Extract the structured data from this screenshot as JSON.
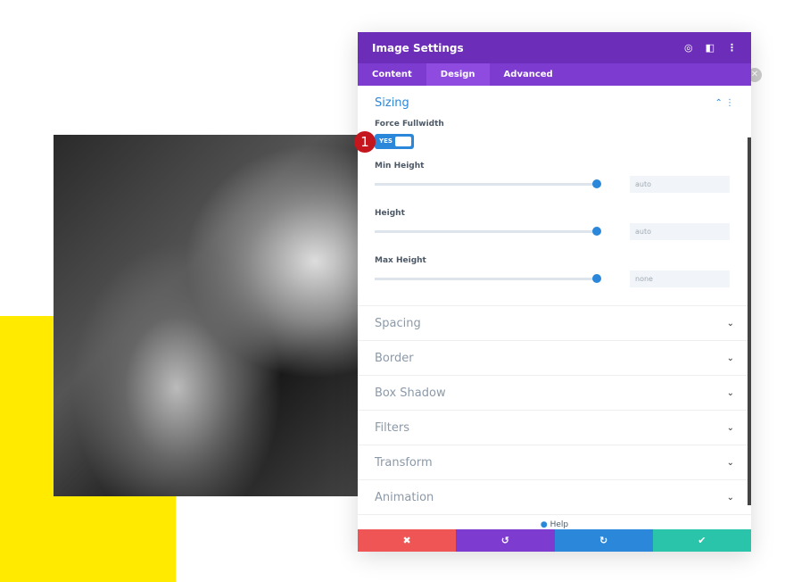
{
  "panel": {
    "title": "Image Settings",
    "tabs": [
      "Content",
      "Design",
      "Advanced"
    ],
    "active_tab": "Design"
  },
  "sizing": {
    "title": "Sizing",
    "force_fullwidth_label": "Force Fullwidth",
    "toggle": "YES",
    "fields": [
      {
        "label": "Min Height",
        "value": "auto"
      },
      {
        "label": "Height",
        "value": "auto"
      },
      {
        "label": "Max Height",
        "value": "none"
      }
    ]
  },
  "sections": [
    "Spacing",
    "Border",
    "Box Shadow",
    "Filters",
    "Transform",
    "Animation"
  ],
  "help": "Help",
  "badge": "1",
  "colors": {
    "header": "#6c2eb9",
    "cancel": "#ef5555",
    "undo": "#7e3bd0",
    "redo": "#2b87da",
    "save": "#29c4a9",
    "yellow": "#ffea00"
  }
}
